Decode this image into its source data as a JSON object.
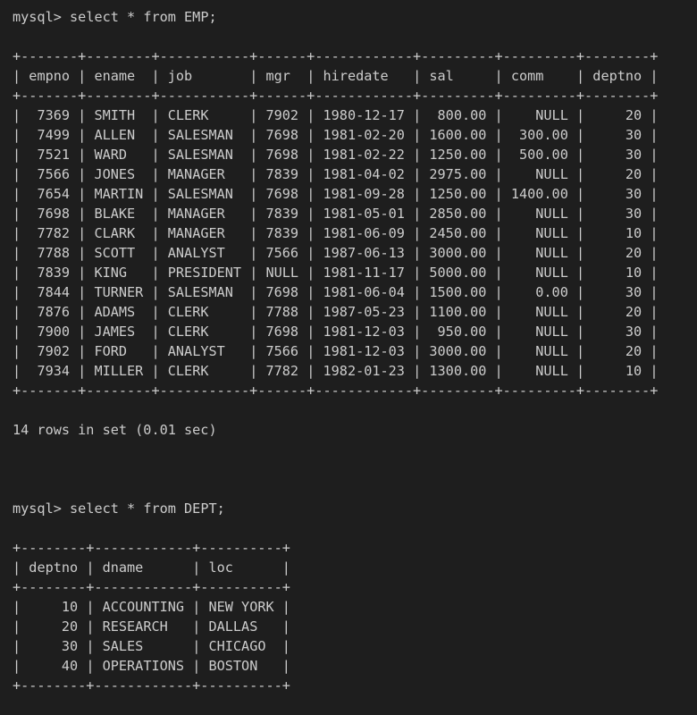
{
  "terminal": {
    "emp_query": {
      "prompt": "mysql>",
      "command": "select * from EMP;",
      "columns": [
        "empno",
        "ename",
        "job",
        "mgr",
        "hiredate",
        "sal",
        "comm",
        "deptno"
      ],
      "rows": [
        [
          "7369",
          "SMITH",
          "CLERK",
          "7902",
          "1980-12-17",
          "800.00",
          "NULL",
          "20"
        ],
        [
          "7499",
          "ALLEN",
          "SALESMAN",
          "7698",
          "1981-02-20",
          "1600.00",
          "300.00",
          "30"
        ],
        [
          "7521",
          "WARD",
          "SALESMAN",
          "7698",
          "1981-02-22",
          "1250.00",
          "500.00",
          "30"
        ],
        [
          "7566",
          "JONES",
          "MANAGER",
          "7839",
          "1981-04-02",
          "2975.00",
          "NULL",
          "20"
        ],
        [
          "7654",
          "MARTIN",
          "SALESMAN",
          "7698",
          "1981-09-28",
          "1250.00",
          "1400.00",
          "30"
        ],
        [
          "7698",
          "BLAKE",
          "MANAGER",
          "7839",
          "1981-05-01",
          "2850.00",
          "NULL",
          "30"
        ],
        [
          "7782",
          "CLARK",
          "MANAGER",
          "7839",
          "1981-06-09",
          "2450.00",
          "NULL",
          "10"
        ],
        [
          "7788",
          "SCOTT",
          "ANALYST",
          "7566",
          "1987-06-13",
          "3000.00",
          "NULL",
          "20"
        ],
        [
          "7839",
          "KING",
          "PRESIDENT",
          "NULL",
          "1981-11-17",
          "5000.00",
          "NULL",
          "10"
        ],
        [
          "7844",
          "TURNER",
          "SALESMAN",
          "7698",
          "1981-06-04",
          "1500.00",
          "0.00",
          "30"
        ],
        [
          "7876",
          "ADAMS",
          "CLERK",
          "7788",
          "1987-05-23",
          "1100.00",
          "NULL",
          "20"
        ],
        [
          "7900",
          "JAMES",
          "CLERK",
          "7698",
          "1981-12-03",
          "950.00",
          "NULL",
          "30"
        ],
        [
          "7902",
          "FORD",
          "ANALYST",
          "7566",
          "1981-12-03",
          "3000.00",
          "NULL",
          "20"
        ],
        [
          "7934",
          "MILLER",
          "CLERK",
          "7782",
          "1982-01-23",
          "1300.00",
          "NULL",
          "10"
        ]
      ],
      "summary": "14 rows in set (0.01 sec)"
    },
    "dept_query": {
      "prompt": "mysql>",
      "command": "select * from DEPT;",
      "columns": [
        "deptno",
        "dname",
        "loc"
      ],
      "rows": [
        [
          "10",
          "ACCOUNTING",
          "NEW YORK"
        ],
        [
          "20",
          "RESEARCH",
          "DALLAS"
        ],
        [
          "30",
          "SALES",
          "CHICAGO"
        ],
        [
          "40",
          "OPERATIONS",
          "BOSTON"
        ]
      ]
    }
  }
}
